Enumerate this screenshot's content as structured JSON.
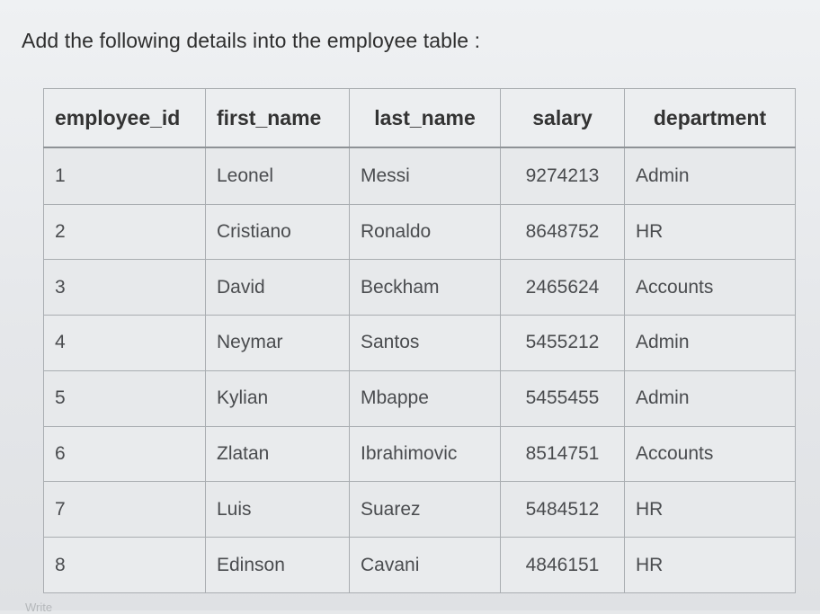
{
  "heading": "Add the following details into the employee table :",
  "table": {
    "columns": [
      "employee_id",
      "first_name",
      "last_name",
      "salary",
      "department"
    ],
    "rows": [
      [
        "1",
        "Leonel",
        "Messi",
        "9274213",
        "Admin"
      ],
      [
        "2",
        "Cristiano",
        "Ronaldo",
        "8648752",
        "HR"
      ],
      [
        "3",
        "David",
        "Beckham",
        "2465624",
        "Accounts"
      ],
      [
        "4",
        "Neymar",
        "Santos",
        "5455212",
        "Admin"
      ],
      [
        "5",
        "Kylian",
        "Mbappe",
        "5455455",
        "Admin"
      ],
      [
        "6",
        "Zlatan",
        "Ibrahimovic",
        "8514751",
        "Accounts"
      ],
      [
        "7",
        "Luis",
        "Suarez",
        "5484512",
        "HR"
      ],
      [
        "8",
        "Edinson",
        "Cavani",
        "4846151",
        "HR"
      ]
    ]
  },
  "footer_hint": "Write"
}
